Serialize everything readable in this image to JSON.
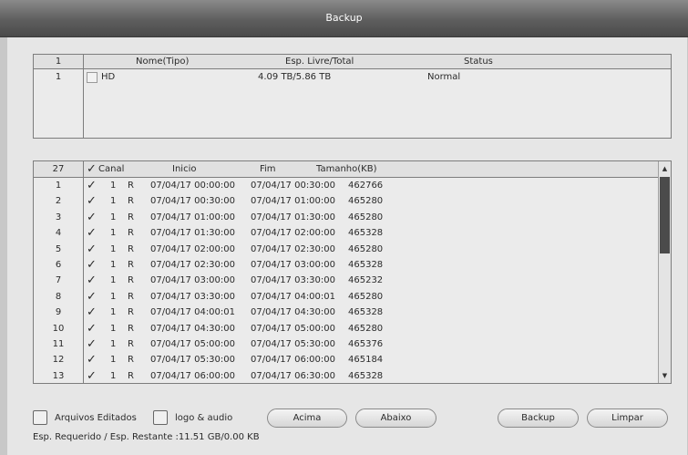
{
  "window": {
    "title": "Backup"
  },
  "devices": {
    "count": "1",
    "headers": {
      "name": "Nome(Tipo)",
      "space": "Esp. Livre/Total",
      "status": "Status"
    },
    "rows": [
      {
        "index": "1",
        "name": "HD",
        "space": "4.09 TB/5.86 TB",
        "status": "Normal"
      }
    ]
  },
  "files": {
    "count": "27",
    "headers": {
      "channel": "Canal",
      "start": "Inicio",
      "end": "Fim",
      "size": "Tamanho(KB)"
    },
    "rows": [
      {
        "index": "1",
        "channel": "1",
        "type": "R",
        "start": "07/04/17 00:00:00",
        "end": "07/04/17 00:30:00",
        "size": "462766"
      },
      {
        "index": "2",
        "channel": "1",
        "type": "R",
        "start": "07/04/17 00:30:00",
        "end": "07/04/17 01:00:00",
        "size": "465280"
      },
      {
        "index": "3",
        "channel": "1",
        "type": "R",
        "start": "07/04/17 01:00:00",
        "end": "07/04/17 01:30:00",
        "size": "465280"
      },
      {
        "index": "4",
        "channel": "1",
        "type": "R",
        "start": "07/04/17 01:30:00",
        "end": "07/04/17 02:00:00",
        "size": "465328"
      },
      {
        "index": "5",
        "channel": "1",
        "type": "R",
        "start": "07/04/17 02:00:00",
        "end": "07/04/17 02:30:00",
        "size": "465280"
      },
      {
        "index": "6",
        "channel": "1",
        "type": "R",
        "start": "07/04/17 02:30:00",
        "end": "07/04/17 03:00:00",
        "size": "465328"
      },
      {
        "index": "7",
        "channel": "1",
        "type": "R",
        "start": "07/04/17 03:00:00",
        "end": "07/04/17 03:30:00",
        "size": "465232"
      },
      {
        "index": "8",
        "channel": "1",
        "type": "R",
        "start": "07/04/17 03:30:00",
        "end": "07/04/17 04:00:01",
        "size": "465280"
      },
      {
        "index": "9",
        "channel": "1",
        "type": "R",
        "start": "07/04/17 04:00:01",
        "end": "07/04/17 04:30:00",
        "size": "465328"
      },
      {
        "index": "10",
        "channel": "1",
        "type": "R",
        "start": "07/04/17 04:30:00",
        "end": "07/04/17 05:00:00",
        "size": "465280"
      },
      {
        "index": "11",
        "channel": "1",
        "type": "R",
        "start": "07/04/17 05:00:00",
        "end": "07/04/17 05:30:00",
        "size": "465376"
      },
      {
        "index": "12",
        "channel": "1",
        "type": "R",
        "start": "07/04/17 05:30:00",
        "end": "07/04/17 06:00:00",
        "size": "465184"
      },
      {
        "index": "13",
        "channel": "1",
        "type": "R",
        "start": "07/04/17 06:00:00",
        "end": "07/04/17 06:30:00",
        "size": "465328"
      }
    ]
  },
  "options": {
    "edited_files": "Arquivos Editados",
    "logo_audio": "logo & audio"
  },
  "buttons": {
    "up": "Acima",
    "down": "Abaixo",
    "backup": "Backup",
    "clear": "Limpar"
  },
  "footer": {
    "space_text": "Esp. Requerido / Esp. Restante :11.51 GB/0.00 KB"
  },
  "icons": {
    "check": "check-mark",
    "scroll_up": "triangle-up",
    "scroll_down": "triangle-down"
  }
}
